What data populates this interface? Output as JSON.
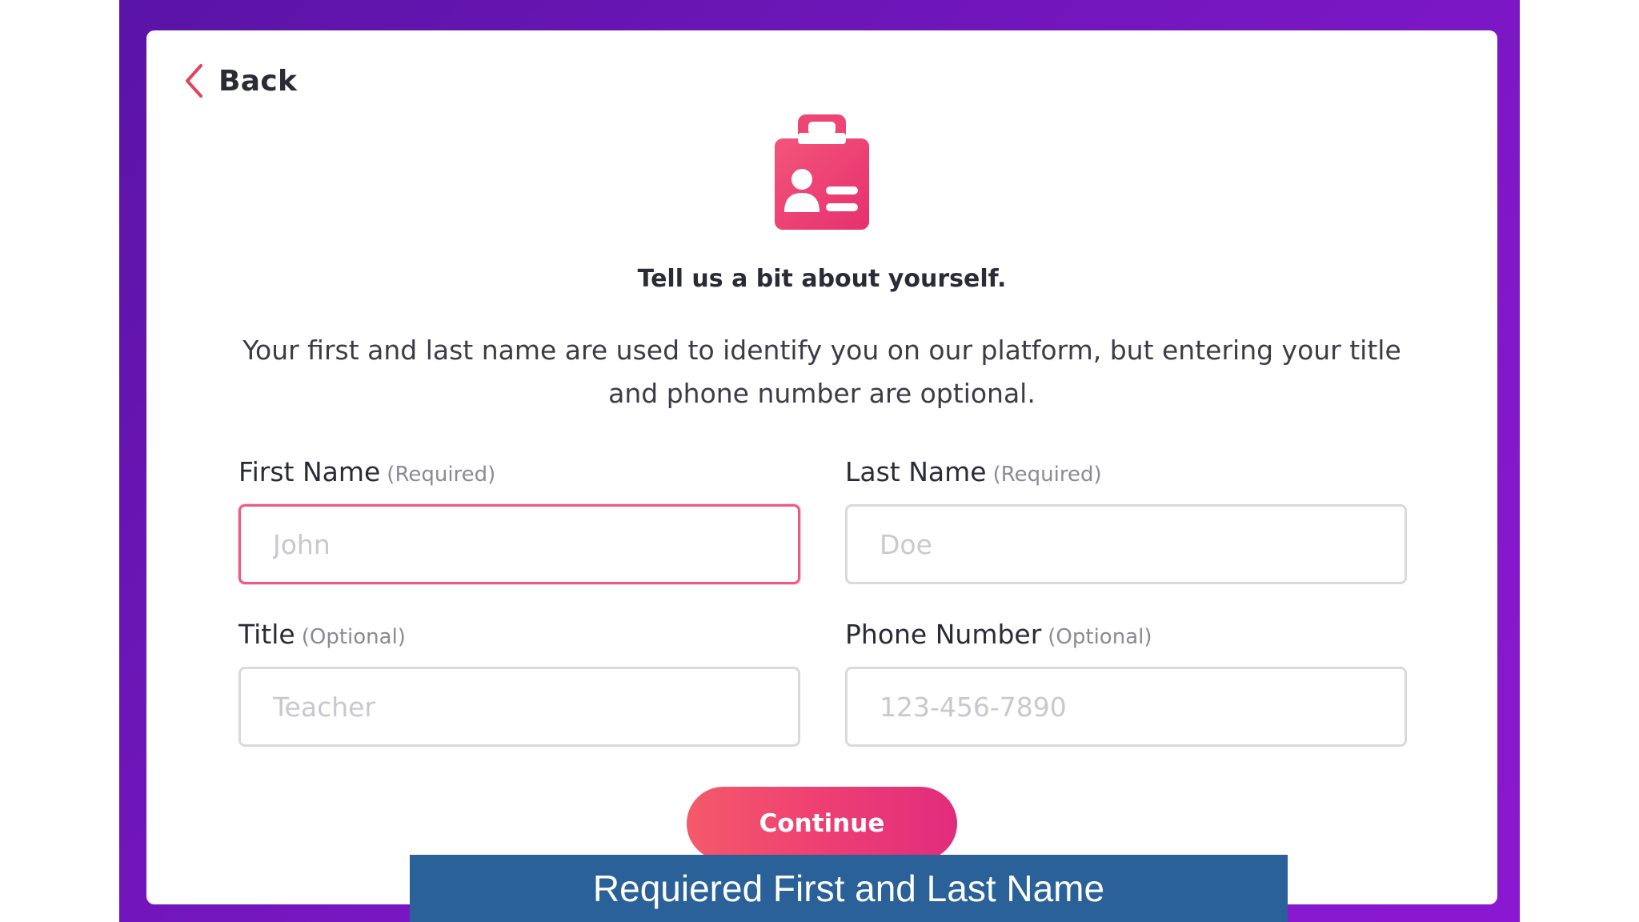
{
  "nav": {
    "back_label": "Back"
  },
  "icons": {
    "back": "chevron-left-icon",
    "header": "id-badge-icon"
  },
  "colors": {
    "accent": "#ec3f72",
    "frame_purple": "#7a17c4",
    "caption_bar": "#2a6198"
  },
  "header": {
    "title": "Tell us a bit about yourself.",
    "description": "Your first and last name are used to identify you on our platform, but entering your title and phone number are optional."
  },
  "form": {
    "first_name": {
      "label": "First Name",
      "note": "(Required)",
      "placeholder": "John",
      "value": ""
    },
    "last_name": {
      "label": "Last Name",
      "note": "(Required)",
      "placeholder": "Doe",
      "value": ""
    },
    "title": {
      "label": "Title",
      "note": "(Optional)",
      "placeholder": "Teacher",
      "value": ""
    },
    "phone": {
      "label": "Phone Number",
      "note": "(Optional)",
      "placeholder": "123-456-7890",
      "value": ""
    }
  },
  "actions": {
    "continue_label": "Continue"
  },
  "caption": {
    "text": "Requiered First and Last Name"
  }
}
